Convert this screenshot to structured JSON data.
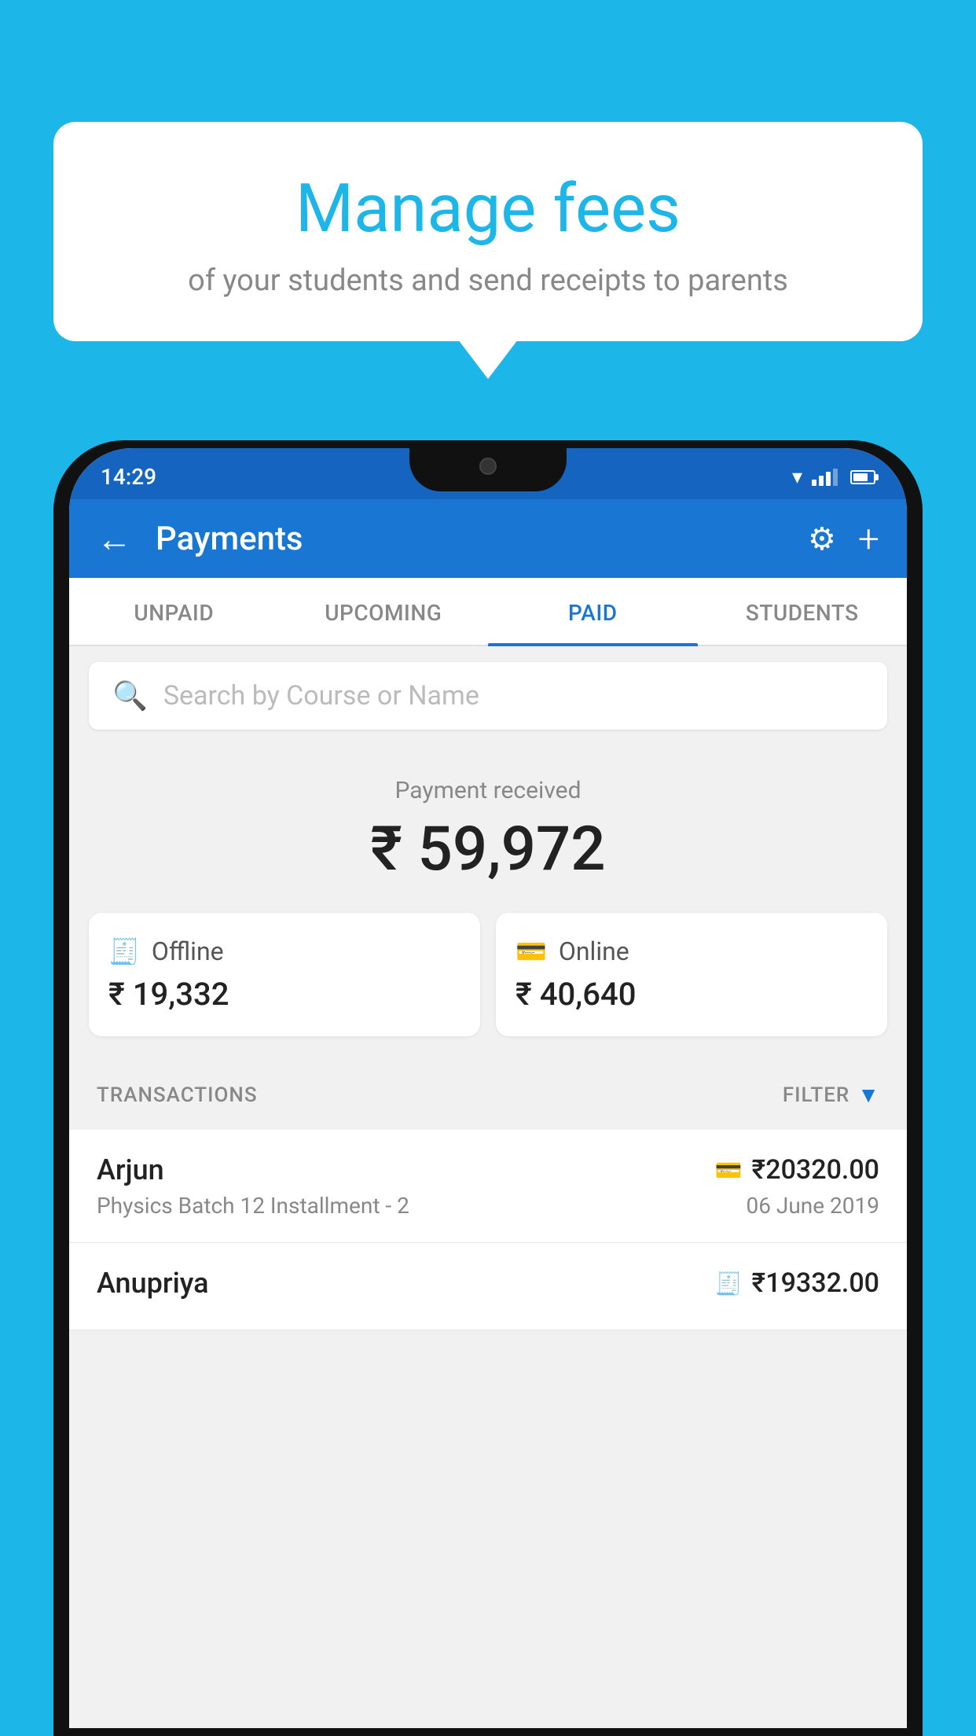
{
  "background_color": "#1db6e8",
  "bubble": {
    "title": "Manage fees",
    "subtitle": "of your students and send receipts to parents"
  },
  "status_bar": {
    "time": "14:29"
  },
  "header": {
    "title": "Payments",
    "back_label": "←",
    "settings_label": "⚙",
    "add_label": "+"
  },
  "tabs": [
    {
      "id": "unpaid",
      "label": "UNPAID",
      "active": false
    },
    {
      "id": "upcoming",
      "label": "UPCOMING",
      "active": false
    },
    {
      "id": "paid",
      "label": "PAID",
      "active": true
    },
    {
      "id": "students",
      "label": "STUDENTS",
      "active": false
    }
  ],
  "search": {
    "placeholder": "Search by Course or Name"
  },
  "payment": {
    "label": "Payment received",
    "amount": "₹ 59,972",
    "offline": {
      "label": "Offline",
      "amount": "₹ 19,332"
    },
    "online": {
      "label": "Online",
      "amount": "₹ 40,640"
    }
  },
  "transactions": {
    "header": "TRANSACTIONS",
    "filter_label": "FILTER",
    "items": [
      {
        "name": "Arjun",
        "course": "Physics Batch 12 Installment - 2",
        "amount": "₹20320.00",
        "date": "06 June 2019",
        "payment_type": "online"
      },
      {
        "name": "Anupriya",
        "course": "",
        "amount": "₹19332.00",
        "date": "",
        "payment_type": "offline"
      }
    ]
  }
}
